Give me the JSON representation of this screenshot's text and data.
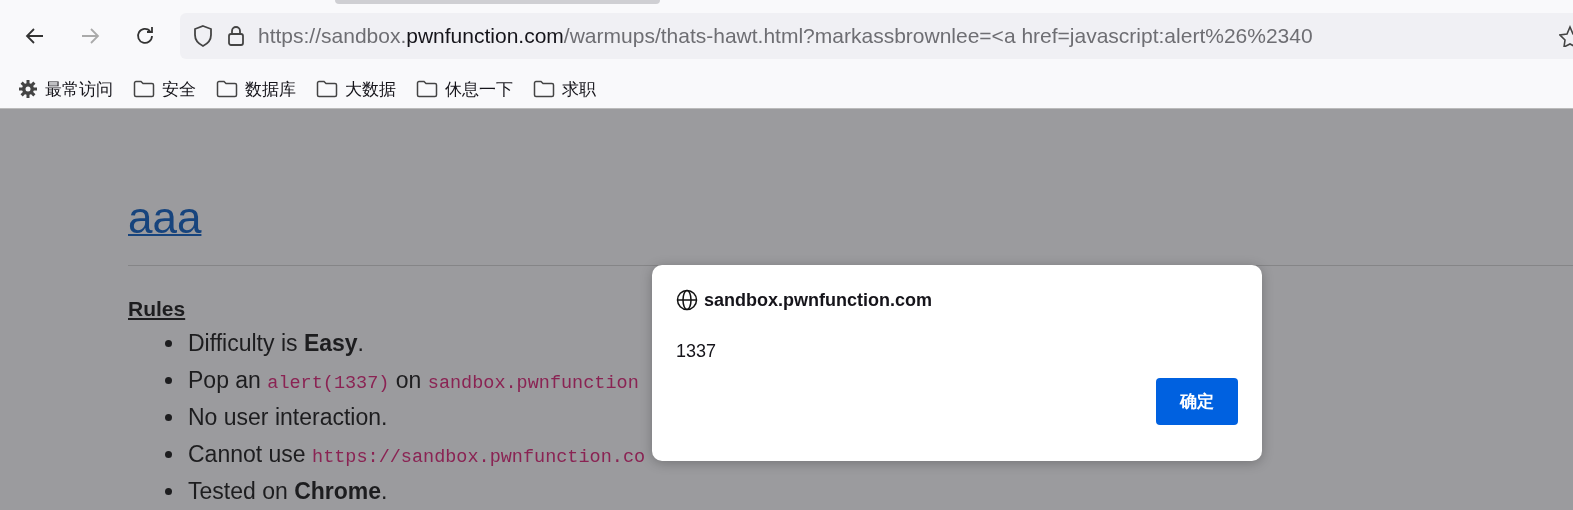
{
  "browser": {
    "nav_buttons": [
      {
        "kind": "back",
        "disabled": false
      },
      {
        "kind": "forward",
        "disabled": true
      },
      {
        "kind": "reload",
        "disabled": false
      }
    ],
    "address": {
      "scheme": "https://",
      "host_prefix": "sandbox.",
      "domain": "pwnfunction.com",
      "path": "/warmups/thats-hawt.html?markassbrownlee=<a href=javascript:alert%26%2340"
    },
    "bookmarks": [
      {
        "kind": "gear",
        "label": "最常访问"
      },
      {
        "kind": "folder",
        "label": "安全"
      },
      {
        "kind": "folder",
        "label": "数据库"
      },
      {
        "kind": "folder",
        "label": "大数据"
      },
      {
        "kind": "folder",
        "label": "休息一下"
      },
      {
        "kind": "folder",
        "label": "求职"
      }
    ]
  },
  "page": {
    "title": "aaa",
    "section": "Rules",
    "rules": [
      [
        {
          "kind": "text",
          "t": "Difficulty is "
        },
        {
          "kind": "bold",
          "t": "Easy"
        },
        {
          "kind": "text",
          "t": "."
        }
      ],
      [
        {
          "kind": "text",
          "t": "Pop an "
        },
        {
          "kind": "code",
          "t": "alert(1337)"
        },
        {
          "kind": "text",
          "t": " on "
        },
        {
          "kind": "code",
          "t": "sandbox.pwnfunction"
        }
      ],
      [
        {
          "kind": "text",
          "t": "No user interaction."
        }
      ],
      [
        {
          "kind": "text",
          "t": "Cannot use "
        },
        {
          "kind": "code",
          "t": "https://sandbox.pwnfunction.co"
        }
      ],
      [
        {
          "kind": "text",
          "t": "Tested on "
        },
        {
          "kind": "bold",
          "t": "Chrome"
        },
        {
          "kind": "text",
          "t": "."
        }
      ]
    ]
  },
  "dialog": {
    "origin": "sandbox.pwnfunction.com",
    "message": "1337",
    "button": "确定"
  }
}
